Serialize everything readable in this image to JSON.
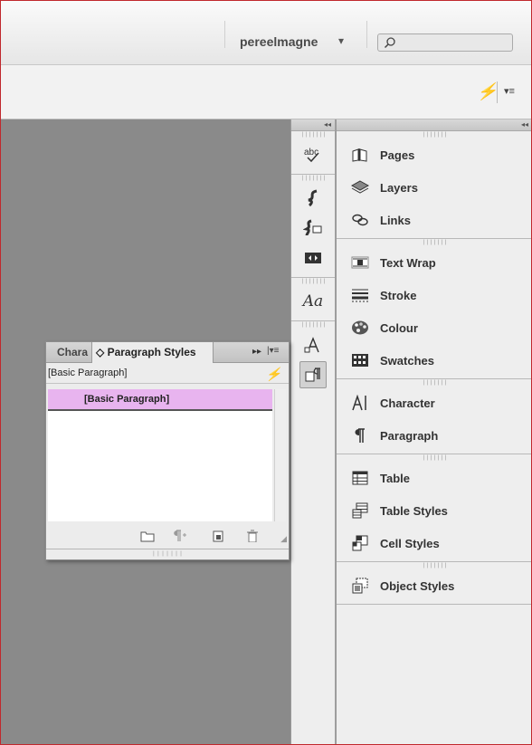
{
  "app_bar": {
    "workspace": "pereelmagne",
    "workspace_arrow": "▾",
    "search": {
      "value": "",
      "placeholder": ""
    }
  },
  "control_bar": {
    "lightning_icon": "⚡",
    "menu_icon": "▾≡"
  },
  "collapse_glyph": "◂◂",
  "grip_glyph": "❘❘❘❘❘❘❘",
  "icon_column": {
    "groups": [
      {
        "icons": [
          "spell-check-icon"
        ]
      },
      {
        "icons": [
          "gradient-feather-icon",
          "effects-icon",
          "position-tool-icon"
        ]
      },
      {
        "icons": [
          "character-styles-icon"
        ]
      },
      {
        "icons": [
          "paragraph-styles-text-icon",
          "paragraph-styles-icon"
        ]
      }
    ],
    "aa_label": "Aa"
  },
  "panel_list": {
    "groups": [
      {
        "items": [
          {
            "label": "Pages",
            "icon": "pages-icon"
          },
          {
            "label": "Layers",
            "icon": "layers-icon"
          },
          {
            "label": "Links",
            "icon": "links-icon"
          }
        ]
      },
      {
        "items": [
          {
            "label": "Text Wrap",
            "icon": "text-wrap-icon"
          },
          {
            "label": "Stroke",
            "icon": "stroke-icon"
          },
          {
            "label": "Colour",
            "icon": "colour-icon"
          },
          {
            "label": "Swatches",
            "icon": "swatches-icon"
          }
        ]
      },
      {
        "items": [
          {
            "label": "Character",
            "icon": "character-icon"
          },
          {
            "label": "Paragraph",
            "icon": "paragraph-icon"
          }
        ]
      },
      {
        "items": [
          {
            "label": "Table",
            "icon": "table-icon"
          },
          {
            "label": "Table Styles",
            "icon": "table-styles-icon"
          },
          {
            "label": "Cell Styles",
            "icon": "cell-styles-icon"
          }
        ]
      },
      {
        "items": [
          {
            "label": "Object Styles",
            "icon": "object-styles-icon"
          }
        ]
      }
    ]
  },
  "paragraph_panel": {
    "tab_character": "Chara",
    "tab_paragraph": "◇ Paragraph Styles",
    "collapse": "▸▸",
    "menu": "|▾≡",
    "current_style": "[Basic Paragraph]",
    "styles": [
      {
        "name": "[Basic Paragraph]",
        "selected": true
      }
    ],
    "selected_color": "#e8b4ef",
    "footer_icons": [
      "new-group-icon",
      "clear-overrides-icon",
      "new-style-icon",
      "delete-icon"
    ]
  },
  "colors": {
    "frame_border": "#c0282d",
    "pasteboard": "#8a8a8a",
    "panel_bg": "#eeeeee"
  }
}
